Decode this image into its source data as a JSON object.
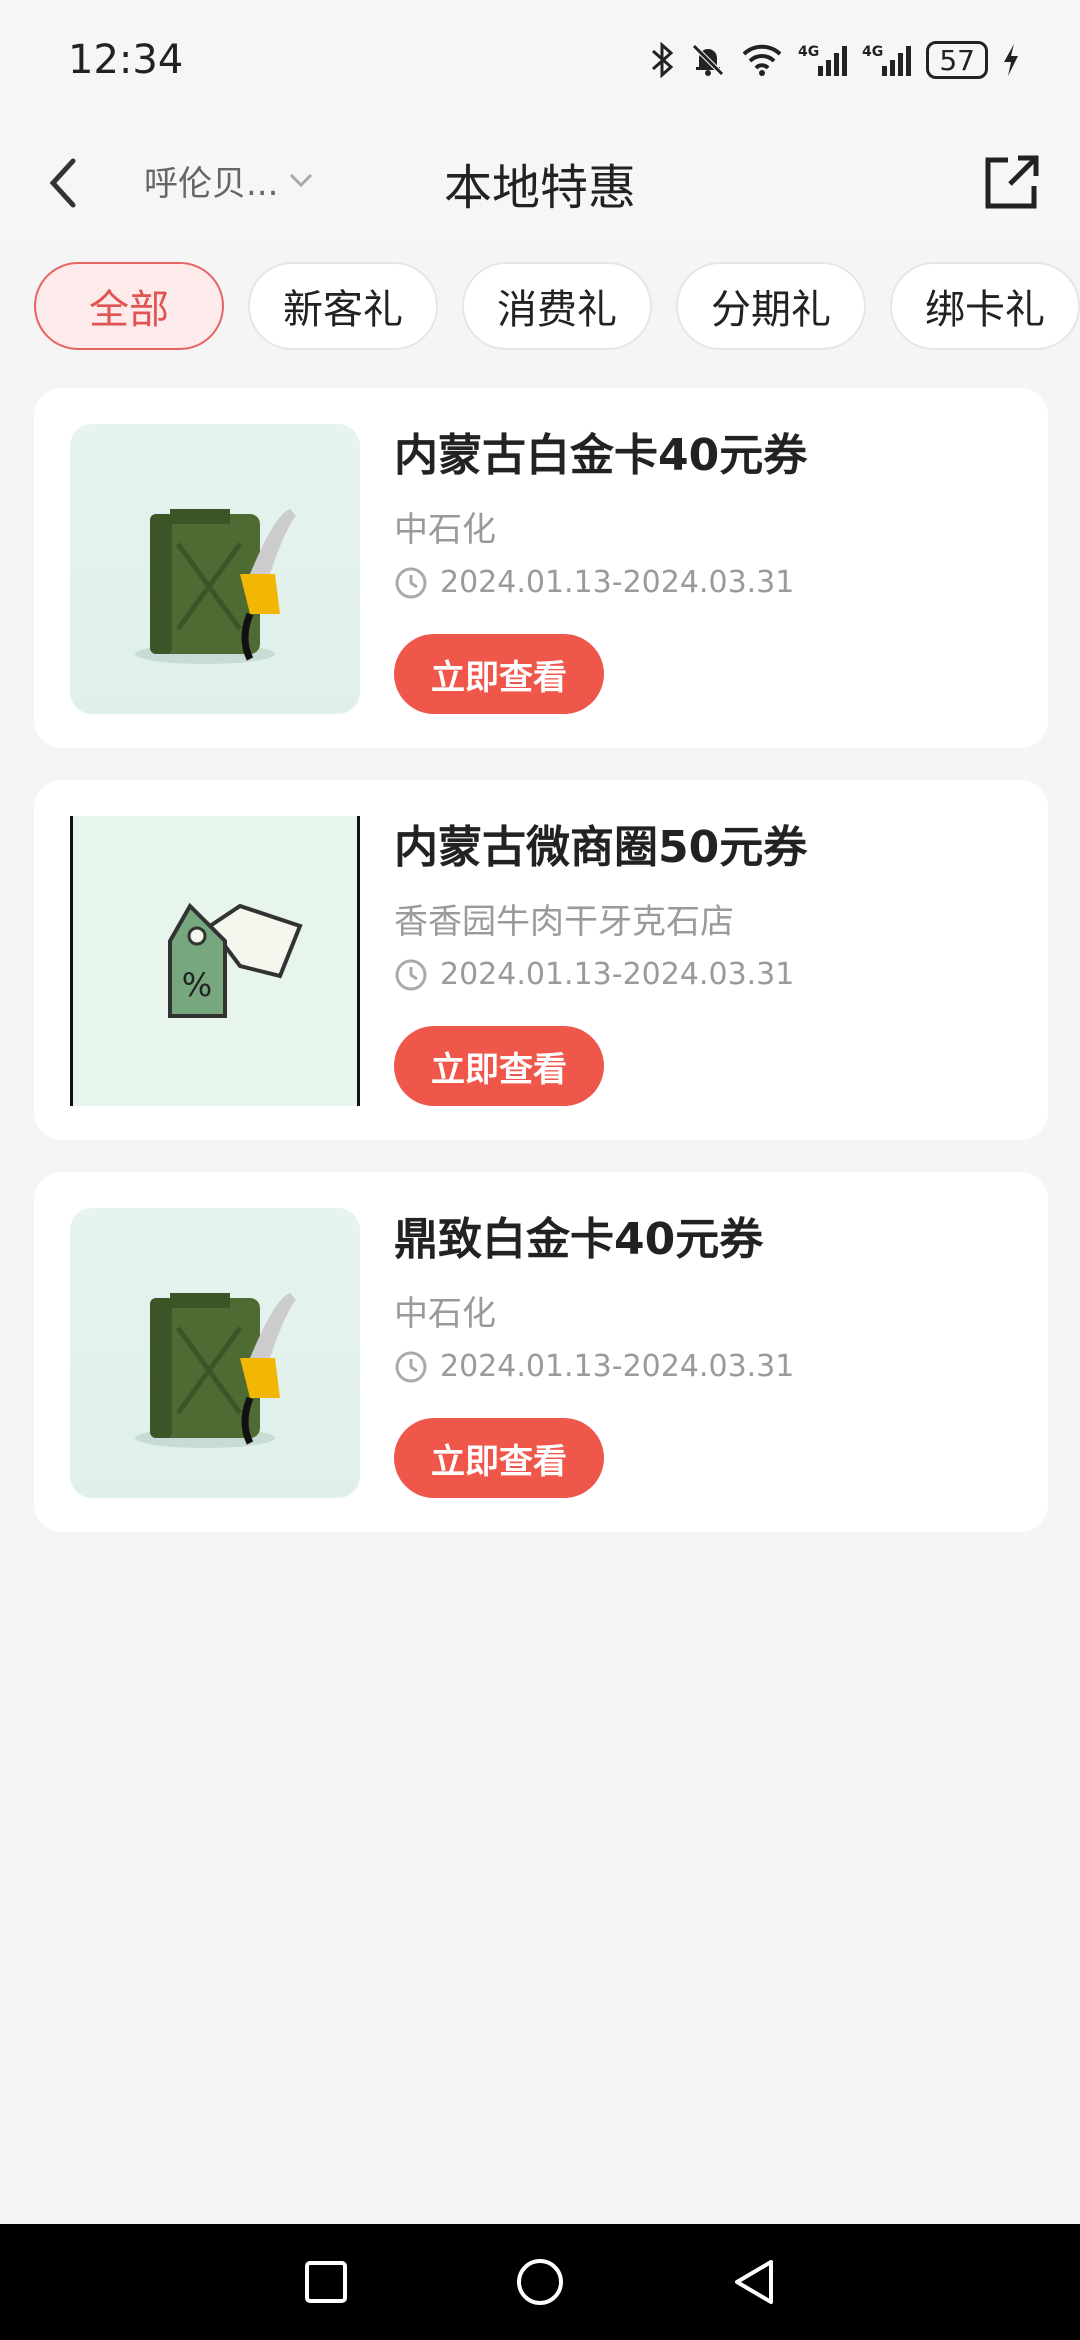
{
  "status_bar": {
    "time": "12:34",
    "battery": "57",
    "icons": [
      "bluetooth-icon",
      "mute-icon",
      "wifi-icon",
      "signal-4g-icon",
      "signal-4g-icon",
      "battery-icon",
      "charging-icon"
    ]
  },
  "header": {
    "city": "呼伦贝...",
    "title": "本地特惠"
  },
  "tabs": [
    {
      "label": "全部",
      "active": true
    },
    {
      "label": "新客礼",
      "active": false
    },
    {
      "label": "消费礼",
      "active": false
    },
    {
      "label": "分期礼",
      "active": false
    },
    {
      "label": "绑卡礼",
      "active": false
    }
  ],
  "coupons": [
    {
      "title": "内蒙古白金卡40元券",
      "merchant": "中石化",
      "date_range": "2024.01.13-2024.03.31",
      "button": "立即查看",
      "image": "fuel-can-icon"
    },
    {
      "title": "内蒙古微商圈50元券",
      "merchant": "香香园牛肉干牙克石店",
      "date_range": "2024.01.13-2024.03.31",
      "button": "立即查看",
      "image": "discount-tag-icon"
    },
    {
      "title": "鼎致白金卡40元券",
      "merchant": "中石化",
      "date_range": "2024.01.13-2024.03.31",
      "button": "立即查看",
      "image": "fuel-can-icon"
    }
  ],
  "colors": {
    "accent": "#f0574b",
    "active_tab_bg": "#fdeaea",
    "active_tab_text": "#e05454"
  }
}
